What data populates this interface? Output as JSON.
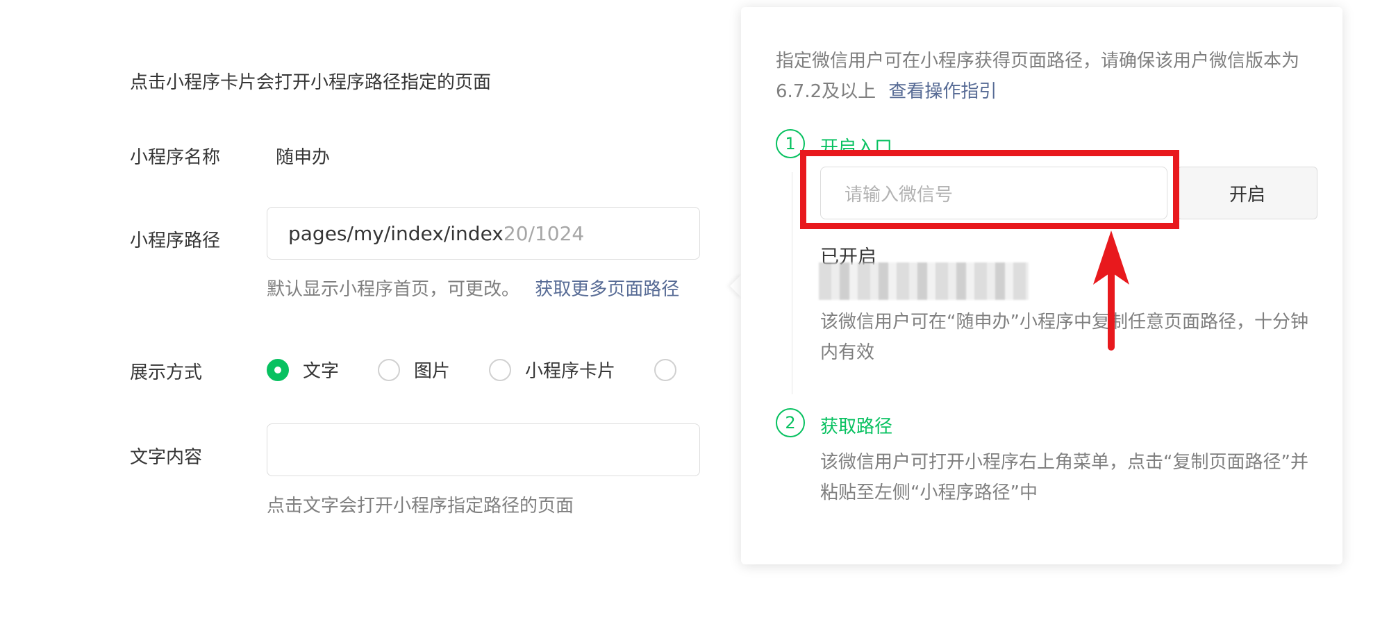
{
  "form": {
    "description": "点击小程序卡片会打开小程序路径指定的页面",
    "name_label": "小程序名称",
    "name_value": "随申办",
    "path_label": "小程序路径",
    "path_value": "pages/my/index/index",
    "path_counter": "20/1024",
    "path_tip": "默认显示小程序首页，可更改。",
    "path_link": "获取更多页面路径",
    "display_label": "展示方式",
    "display_options": [
      "文字",
      "图片",
      "小程序卡片"
    ],
    "display_selected": "文字",
    "text_label": "文字内容",
    "text_value": "",
    "text_tip": "点击文字会打开小程序指定路径的页面"
  },
  "popover": {
    "desc": "指定微信用户可在小程序获得页面路径，请确保该用户微信版本为6.7.2及以上",
    "guide_link": "查看操作指引",
    "step1": {
      "num": "1",
      "title": "开启入口",
      "input_placeholder": "请输入微信号",
      "button": "开启",
      "status": "已开启",
      "note": "该微信用户可在“随申办”小程序中复制任意页面路径，十分钟内有效"
    },
    "step2": {
      "num": "2",
      "title": "获取路径",
      "note": "该微信用户可打开小程序右上角菜单，点击“复制页面路径”并粘贴至左侧“小程序路径”中"
    }
  },
  "colors": {
    "accent_green": "#07c160",
    "link_blue": "#576b95",
    "annotation_red": "#e8191d"
  }
}
